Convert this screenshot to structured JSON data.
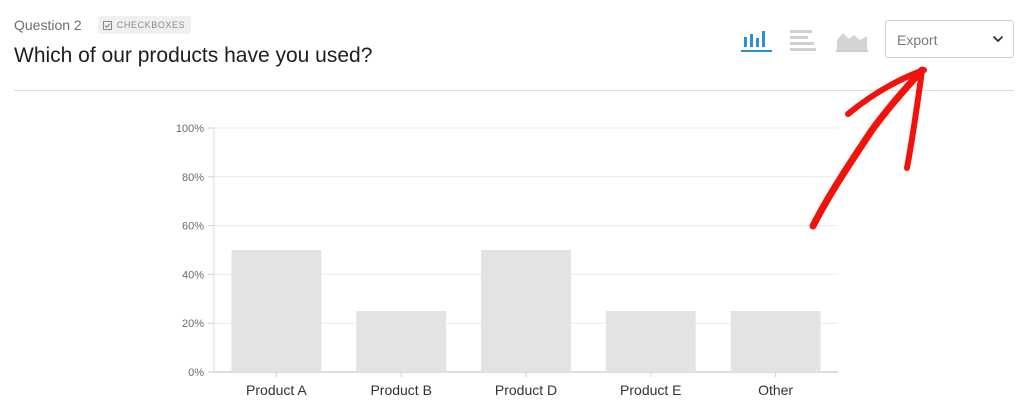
{
  "question": {
    "number_label": "Question 2",
    "type_badge": "CHECKBOXES",
    "title": "Which of our products have you used?"
  },
  "toolbar": {
    "view_icons": [
      "bar-chart-icon",
      "horizontal-bar-chart-icon",
      "area-chart-icon"
    ],
    "active_view": "bar-chart-icon",
    "export_label": "Export"
  },
  "colors": {
    "bar_fill": "#e3e3e3",
    "accent": "#2e8fd1",
    "annotation_arrow": "#f2120c"
  },
  "chart_data": {
    "type": "bar",
    "categories": [
      "Product A",
      "Product B",
      "Product D",
      "Product E",
      "Other"
    ],
    "values": [
      50,
      25,
      50,
      25,
      25
    ],
    "y_ticks": [
      "0%",
      "20%",
      "40%",
      "60%",
      "80%",
      "100%"
    ],
    "ylim": [
      0,
      100
    ],
    "grid": true
  }
}
